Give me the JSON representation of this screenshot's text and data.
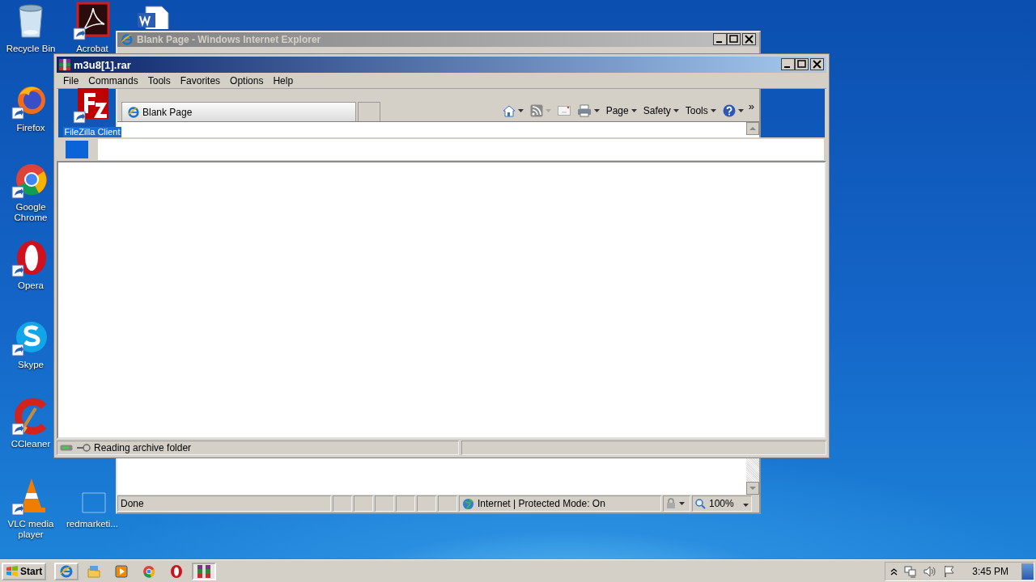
{
  "desktop_icons": [
    {
      "kind": "recycle-bin",
      "label": "Recycle Bin",
      "shortcut": false,
      "selected": false
    },
    {
      "kind": "acrobat",
      "label": "Acrobat",
      "shortcut": true,
      "selected": false
    },
    {
      "kind": "word",
      "shortcut": false,
      "selected": false
    },
    {
      "kind": "firefox",
      "label": "Firefox",
      "shortcut": true,
      "selected": false
    },
    {
      "kind": "filezilla",
      "label": "FileZilla Client",
      "shortcut": true,
      "selected": true
    },
    {
      "kind": "chrome",
      "label": "Google Chrome",
      "shortcut": true,
      "selected": false
    },
    {
      "kind": "opera",
      "label": "Opera",
      "shortcut": true,
      "selected": false
    },
    {
      "kind": "skype",
      "label": "Skype",
      "shortcut": true,
      "selected": false
    },
    {
      "kind": "ccleaner",
      "label": "CCleaner",
      "shortcut": true,
      "selected": false
    },
    {
      "kind": "vlc",
      "label": "VLC media player",
      "shortcut": true,
      "selected": false
    },
    {
      "kind": "file",
      "label": "redmarketi...",
      "shortcut": false,
      "selected": false
    }
  ],
  "ie_window": {
    "title": "Blank Page - Windows Internet Explorer",
    "active": false,
    "tab": {
      "label": "Blank Page"
    },
    "commands": [
      {
        "kind": "home"
      },
      {
        "kind": "feeds"
      },
      {
        "kind": "mail"
      },
      {
        "kind": "print"
      },
      {
        "kind": "menu",
        "label": "Page"
      },
      {
        "kind": "menu",
        "label": "Safety"
      },
      {
        "kind": "menu",
        "label": "Tools"
      },
      {
        "kind": "help"
      }
    ],
    "overflow": "»",
    "status": "Done",
    "zone": "Internet | Protected Mode: On",
    "zoom": "100%"
  },
  "archive_window": {
    "title": "m3u8[1].rar",
    "active": true,
    "menu": [
      "File",
      "Commands",
      "Tools",
      "Favorites",
      "Options",
      "Help"
    ],
    "status": "Reading archive folder"
  },
  "taskbar": {
    "start": "Start",
    "tasks": [
      {
        "kind": "ie",
        "open": true,
        "selected": false
      },
      {
        "kind": "explorer",
        "open": false,
        "selected": false
      },
      {
        "kind": "media",
        "open": false,
        "selected": false
      },
      {
        "kind": "chrome",
        "open": false,
        "selected": false
      },
      {
        "kind": "opera",
        "open": false,
        "selected": false
      },
      {
        "kind": "winrar",
        "open": true,
        "selected": true
      }
    ],
    "clock": "3:45 PM"
  }
}
